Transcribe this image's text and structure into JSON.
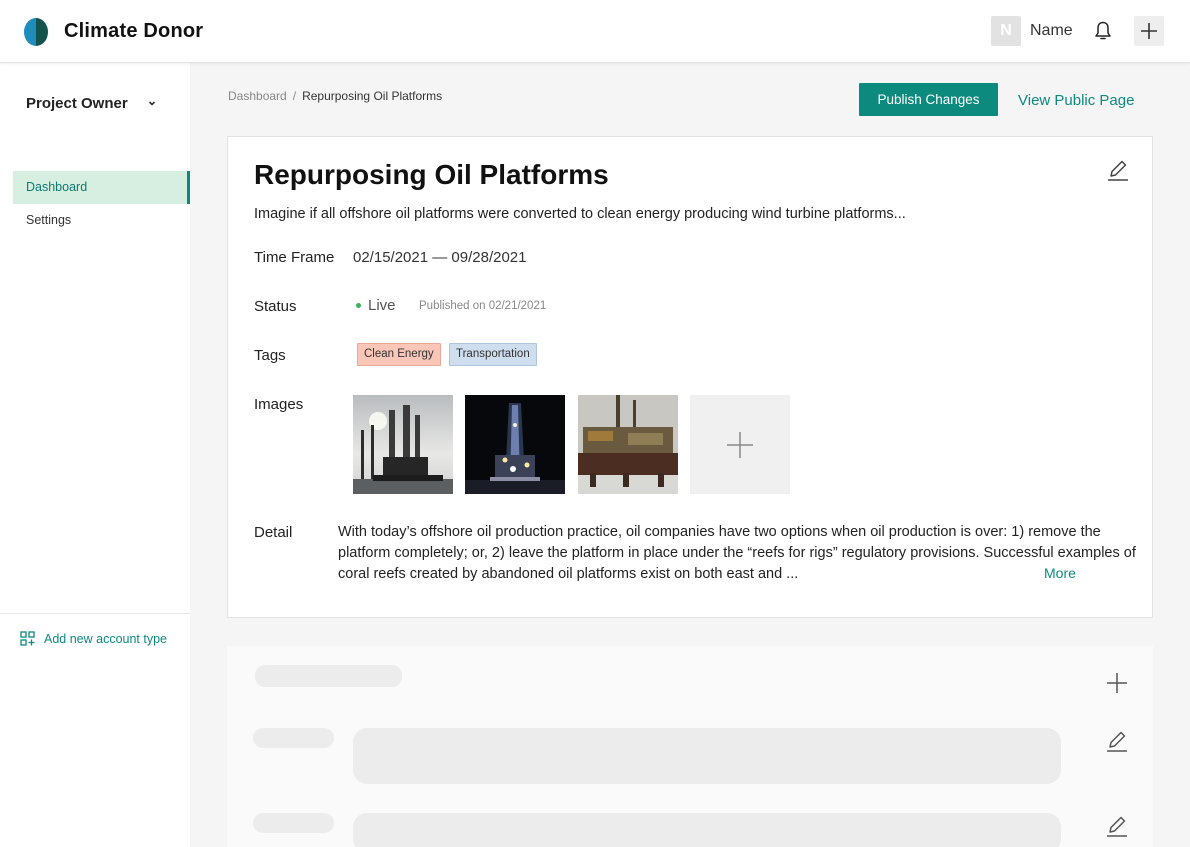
{
  "header": {
    "brand": "Climate Donor",
    "avatar_initial": "N",
    "user_name": "Name"
  },
  "sidebar": {
    "role": "Project Owner",
    "items": [
      {
        "label": "Dashboard",
        "active": true
      },
      {
        "label": "Settings",
        "active": false
      }
    ],
    "add_account_label": "Add new account type"
  },
  "breadcrumb": {
    "root": "Dashboard",
    "separator": "/",
    "current": "Repurposing Oil Platforms"
  },
  "actions": {
    "publish_label": "Publish Changes",
    "view_public_label": "View Public Page"
  },
  "project": {
    "title": "Repurposing Oil Platforms",
    "summary": "Imagine if all offshore oil platforms were converted to clean energy producing wind turbine platforms...",
    "labels": {
      "time_frame": "Time Frame",
      "status": "Status",
      "tags": "Tags",
      "images": "Images",
      "detail": "Detail"
    },
    "time_frame": "02/15/2021 — 09/28/2021",
    "status": "Live",
    "published": "Published on 02/21/2021",
    "tags": [
      "Clean Energy",
      "Transportation"
    ],
    "images": [
      "oil-platform-daylight",
      "oil-platform-night",
      "oil-platform-harbor"
    ],
    "detail": "With today’s offshore oil production practice, oil companies have two options when oil production is over: 1) remove the platform completely; or, 2) leave the platform in place under the “reefs for rigs” regulatory provisions. Successful examples of coral reefs created by abandoned oil platforms exist on both east and ...",
    "more_label": "More"
  },
  "colors": {
    "accent": "#0c8a7e",
    "active_nav_bg": "#d7efe1",
    "live_dot": "#3cb35a",
    "tag_clean_energy": "#f9c6b7",
    "tag_transportation": "#cfdeef"
  }
}
